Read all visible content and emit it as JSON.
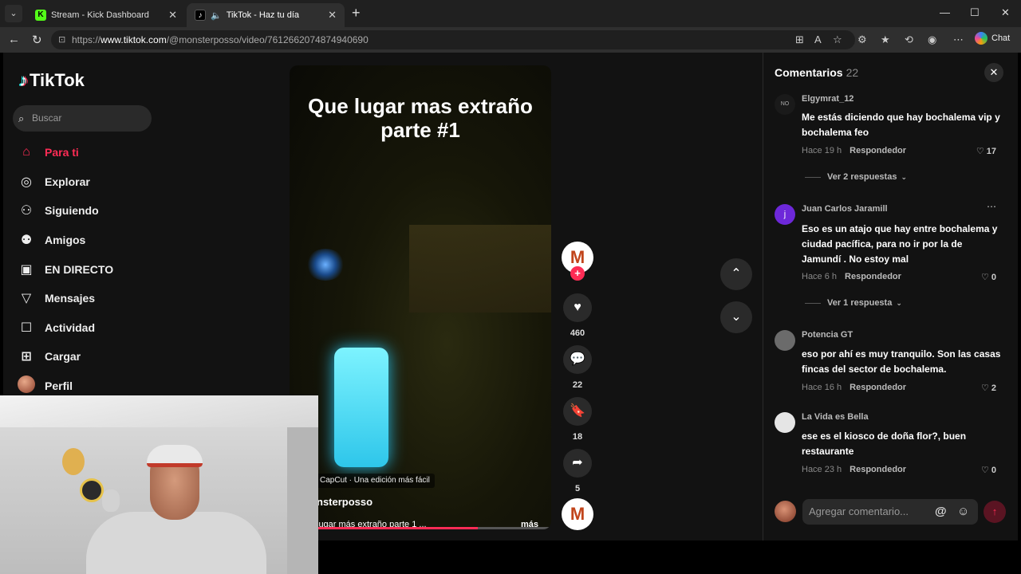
{
  "browser": {
    "tabs": [
      {
        "title": "Stream - Kick Dashboard",
        "favicon": "K"
      },
      {
        "title": "TikTok - Haz tu día",
        "favicon": "♪"
      }
    ],
    "url_prefix": "https://",
    "url_host": "www.tiktok.com",
    "url_path": "/@monsterposso/video/7612662074874940690",
    "chat_label": "Chat"
  },
  "sidebar": {
    "logo": "TikTok",
    "search_placeholder": "Buscar",
    "items": [
      {
        "label": "Para ti",
        "icon": "home-icon"
      },
      {
        "label": "Explorar",
        "icon": "compass-icon"
      },
      {
        "label": "Siguiendo",
        "icon": "following-icon"
      },
      {
        "label": "Amigos",
        "icon": "friends-icon"
      },
      {
        "label": "EN DIRECTO",
        "icon": "live-icon"
      },
      {
        "label": "Mensajes",
        "icon": "messages-icon"
      },
      {
        "label": "Actividad",
        "icon": "activity-icon"
      },
      {
        "label": "Cargar",
        "icon": "upload-icon"
      },
      {
        "label": "Perfil",
        "icon": "profile-avatar"
      }
    ]
  },
  "video": {
    "title_overlay": "Que lugar mas extraño parte #1",
    "capcut_tag": "CapCut · Una edición más fácil",
    "author": "nsterposso",
    "description": "lugar más extraño parte 1 ...",
    "more_label": "más",
    "progress": 0.72
  },
  "actions": {
    "likes": "460",
    "comments": "22",
    "saves": "18",
    "shares": "5"
  },
  "comments": {
    "header": "Comentarios",
    "count": "22",
    "items": [
      {
        "user": "Elgymrat_12",
        "text": "Me estás diciendo que hay bochalema vip y bochalema feo",
        "time": "Hace 19 h",
        "reply": "Respondedor",
        "likes": "17",
        "view_replies": "Ver 2 respuestas"
      },
      {
        "user": "Juan Carlos Jaramill",
        "avatar_letter": "j",
        "text": "Eso es un atajo que hay entre bochalema y ciudad pacífica, para no ir por la de Jamundí . No estoy mal",
        "time": "Hace 6 h",
        "reply": "Respondedor",
        "likes": "0",
        "view_replies": "Ver 1 respuesta"
      },
      {
        "user": "Potencia GT",
        "text": "eso por ahí es muy tranquilo. Son las casas fincas del sector de bochalema.",
        "time": "Hace 16 h",
        "reply": "Respondedor",
        "likes": "2"
      },
      {
        "user": "La Vida es Bella",
        "text": "ese es el kiosco de doña flor?, buen restaurante",
        "time": "Hace 23 h",
        "reply": "Respondedor",
        "likes": "0"
      }
    ],
    "input_placeholder": "Agregar comentario..."
  },
  "colors": {
    "accent": "#fe2c55",
    "background": "#121212"
  }
}
